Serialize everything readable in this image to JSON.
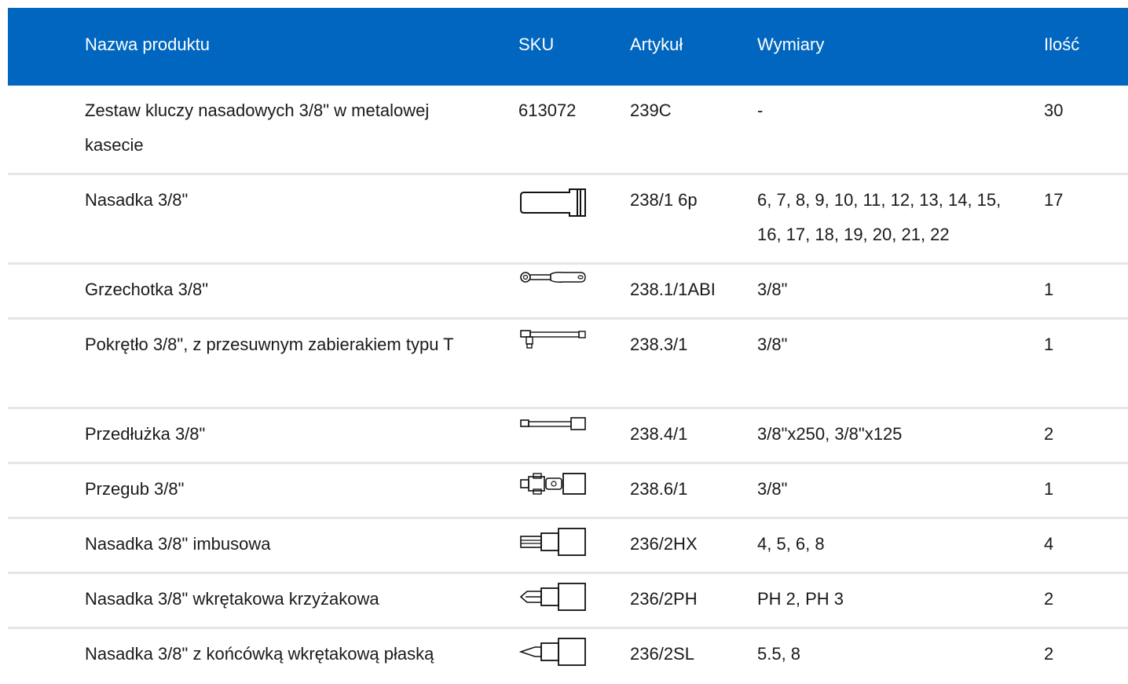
{
  "colors": {
    "header_bg": "#0066bf",
    "header_text": "#ffffff",
    "divider": "#e6e6e6"
  },
  "table": {
    "headers": {
      "name": "Nazwa produktu",
      "sku": "SKU",
      "article": "Artykuł",
      "dimensions": "Wymiary",
      "quantity": "Ilość"
    },
    "rows": [
      {
        "name": "Zestaw kluczy nasadowych 3/8\" w metalowej kasecie",
        "sku": "613072",
        "article": "239C",
        "dimensions": "-",
        "quantity": "30",
        "icon": ""
      },
      {
        "name": "Nasadka 3/8\"",
        "sku": "",
        "article": "238/1 6p",
        "dimensions": "6, 7, 8, 9, 10, 11, 12, 13, 14, 15, 16, 17, 18, 19, 20, 21, 22",
        "quantity": "17",
        "icon": "socket-icon"
      },
      {
        "name": "Grzechotka 3/8\"",
        "sku": "",
        "article": "238.1/1ABI",
        "dimensions": "3/8\"",
        "quantity": "1",
        "icon": "ratchet-icon"
      },
      {
        "name": "Pokrętło 3/8\", z przesuwnym zabierakiem typu T",
        "sku": "",
        "article": "238.3/1",
        "dimensions": "3/8\"",
        "quantity": "1",
        "icon": "t-handle-icon"
      },
      {
        "name": "Przedłużka 3/8\"",
        "sku": "",
        "article": "238.4/1",
        "dimensions": "3/8\"x250, 3/8\"x125",
        "quantity": "2",
        "icon": "extension-bar-icon"
      },
      {
        "name": "Przegub 3/8\"",
        "sku": "",
        "article": "238.6/1",
        "dimensions": "3/8\"",
        "quantity": "1",
        "icon": "universal-joint-icon"
      },
      {
        "name": "Nasadka 3/8\" imbusowa",
        "sku": "",
        "article": "236/2HX",
        "dimensions": "4, 5, 6, 8",
        "quantity": "4",
        "icon": "hex-bit-socket-icon"
      },
      {
        "name": "Nasadka 3/8\" wkrętakowa krzyżakowa",
        "sku": "",
        "article": "236/2PH",
        "dimensions": "PH 2, PH 3",
        "quantity": "2",
        "icon": "phillips-bit-socket-icon"
      },
      {
        "name": "Nasadka 3/8\" z końcówką wkrętakową płaską",
        "sku": "",
        "article": "236/2SL",
        "dimensions": "5.5, 8",
        "quantity": "2",
        "icon": "slotted-bit-socket-icon"
      }
    ]
  }
}
